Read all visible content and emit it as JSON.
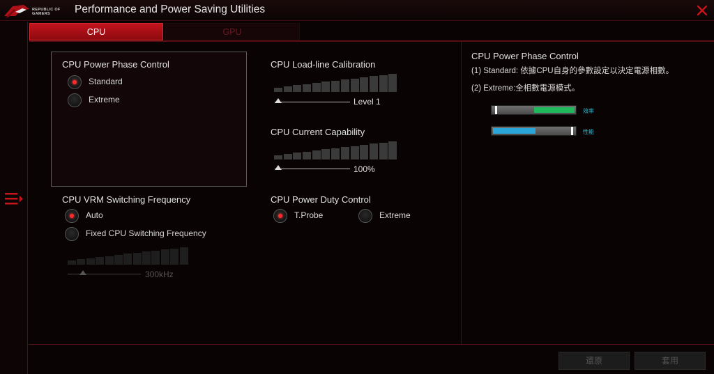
{
  "window": {
    "brand_text": "REPUBLIC OF GAMERS",
    "title": "Performance and Power Saving Utilities"
  },
  "tabs": [
    {
      "label": "CPU",
      "active": true
    },
    {
      "label": "GPU",
      "active": false
    }
  ],
  "power_phase": {
    "title": "CPU Power Phase Control",
    "options": [
      {
        "label": "Standard",
        "selected": true
      },
      {
        "label": "Extreme",
        "selected": false
      }
    ]
  },
  "vrm": {
    "title": "CPU VRM Switching Frequency",
    "options": [
      {
        "label": "Auto",
        "selected": true
      },
      {
        "label": "Fixed CPU Switching Frequency",
        "selected": false
      }
    ],
    "slider_value": "300kHz",
    "slider_level": 0.0,
    "slider_enabled": false
  },
  "llc": {
    "title": "CPU Load-line Calibration",
    "slider_value": "Level 1",
    "slider_level": 0.0
  },
  "current_capability": {
    "title": "CPU Current Capability",
    "slider_value": "100%",
    "slider_level": 0.0
  },
  "duty_control": {
    "title": "CPU Power Duty Control",
    "options": [
      {
        "label": "T.Probe",
        "selected": true
      },
      {
        "label": "Extreme",
        "selected": false
      }
    ]
  },
  "description": {
    "title": "CPU Power Phase Control",
    "line1": "(1) Standard: 依據CPU自身的參數設定以決定電源相數。",
    "line2": "(2) Extreme:全相數電源模式。",
    "meters": [
      {
        "label": "效率",
        "color": "#1fb85a",
        "level": 0.5
      },
      {
        "label": "性能",
        "color": "#2aa7d8",
        "level": 0.5
      }
    ]
  },
  "buttons": {
    "undo": "還原",
    "apply": "套用"
  },
  "colors": {
    "accent": "#c1141b",
    "radio_dot": "#ff2a2a"
  }
}
